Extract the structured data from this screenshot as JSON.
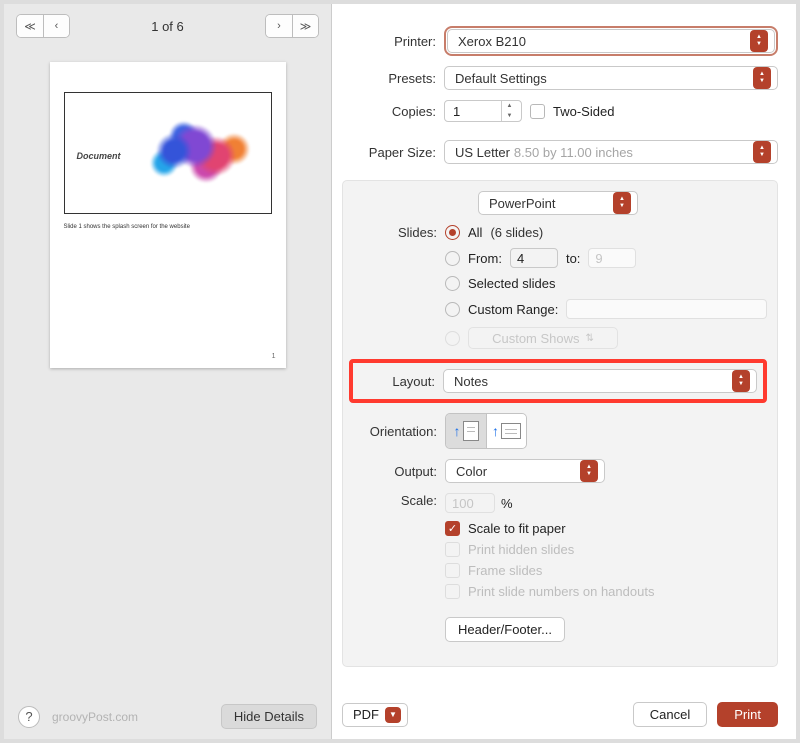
{
  "preview": {
    "page_indicator": "1 of 6",
    "slide_title": "Document",
    "notes_caption": "Slide 1 shows the splash screen for the website",
    "page_num": "1"
  },
  "footer": {
    "watermark": "groovyPost.com",
    "hide_details": "Hide Details",
    "help": "?"
  },
  "settings": {
    "printer_label": "Printer:",
    "printer_value": "Xerox B210",
    "presets_label": "Presets:",
    "presets_value": "Default Settings",
    "copies_label": "Copies:",
    "copies_value": "1",
    "two_sided": "Two-Sided",
    "paper_size_label": "Paper Size:",
    "paper_size_value": "US Letter",
    "paper_size_dims": "8.50 by 11.00 inches",
    "app_select": "PowerPoint",
    "slides_label": "Slides:",
    "slides_all": "All",
    "slides_all_count": "(6 slides)",
    "slides_from": "From:",
    "slides_from_val": "4",
    "slides_to": "to:",
    "slides_to_val": "9",
    "slides_selected": "Selected slides",
    "slides_custom_range": "Custom Range:",
    "slides_custom_shows": "Custom Shows",
    "layout_label": "Layout:",
    "layout_value": "Notes",
    "orientation_label": "Orientation:",
    "output_label": "Output:",
    "output_value": "Color",
    "scale_label": "Scale:",
    "scale_value": "100",
    "scale_pct": "%",
    "scale_fit": "Scale to fit paper",
    "print_hidden": "Print hidden slides",
    "frame_slides": "Frame slides",
    "print_numbers": "Print slide numbers on handouts",
    "header_footer": "Header/Footer..."
  },
  "actions": {
    "pdf": "PDF",
    "cancel": "Cancel",
    "print": "Print"
  }
}
